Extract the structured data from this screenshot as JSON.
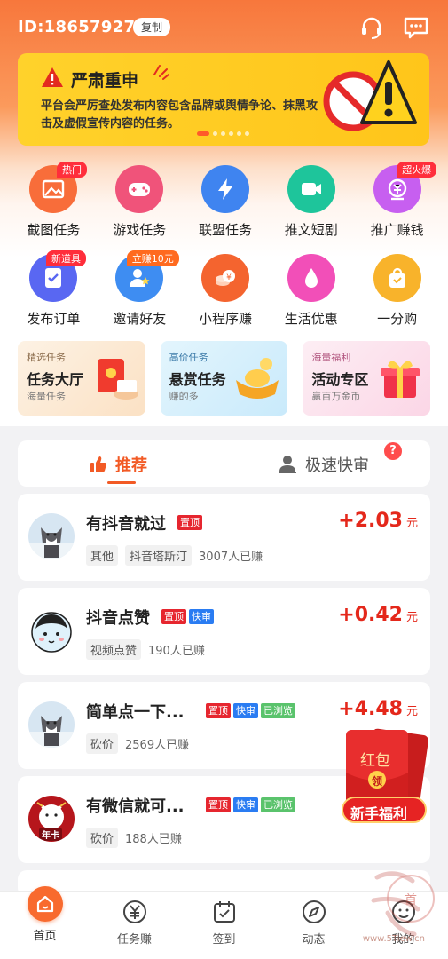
{
  "header": {
    "user_id": "ID:18657927",
    "copy_label": "复制",
    "icons": [
      "headset-icon",
      "message-icon"
    ]
  },
  "banner": {
    "title": "严肃重申",
    "text": "平台会严厉查处发布内容包含品牌或舆情争论、抹黑攻击及虚假宣传内容的任务。",
    "slide_count": 6,
    "active_slide": 1
  },
  "grid": {
    "rows": [
      [
        {
          "label": "截图任务",
          "badge": "热门",
          "icon": "image-icon",
          "color": "#f86d3a"
        },
        {
          "label": "游戏任务",
          "badge": "",
          "icon": "gamepad-icon",
          "color": "#f0537a"
        },
        {
          "label": "联盟任务",
          "badge": "",
          "icon": "lightning-icon",
          "color": "#3f84f0"
        },
        {
          "label": "推文短剧",
          "badge": "",
          "icon": "video-icon",
          "color": "#1ec59b"
        },
        {
          "label": "推广赚钱",
          "badge": "超火爆",
          "icon": "coin-icon",
          "color": "#c75ff0"
        }
      ],
      [
        {
          "label": "发布订单",
          "badge": "新道具",
          "icon": "order-icon",
          "color": "#5967f2"
        },
        {
          "label": "邀请好友",
          "badge": "立赚10元",
          "icon": "friend-icon",
          "color": "#3e8df2"
        },
        {
          "label": "小程序赚",
          "badge": "",
          "icon": "coins-icon",
          "color": "#f4642f"
        },
        {
          "label": "生活优惠",
          "badge": "",
          "icon": "drop-icon",
          "color": "#f24fb8"
        },
        {
          "label": "一分购",
          "badge": "",
          "icon": "bag-icon",
          "color": "#f8b32b"
        }
      ]
    ]
  },
  "promos": [
    {
      "tag": "精选任务",
      "title": "任务大厅",
      "sub": "海量任务",
      "bg": "#fdeedd"
    },
    {
      "tag": "高价任务",
      "title": "悬赏任务",
      "sub": "赚的多",
      "bg": "#dbf1fb"
    },
    {
      "tag": "海量福利",
      "title": "活动专区",
      "sub": "赢百万金币",
      "bg": "#fde6f0"
    }
  ],
  "tabs": [
    {
      "label": "推荐",
      "active": true
    },
    {
      "label": "极速快审",
      "active": false
    }
  ],
  "help_mark": "?",
  "tasks": [
    {
      "title": "有抖音就过",
      "tags": [
        {
          "text": "置顶",
          "color": "red"
        }
      ],
      "chips": [
        "其他",
        "抖音塔斯汀"
      ],
      "count": "3007人已赚",
      "reward": "+2.03",
      "unit": "元",
      "avatar": "husky"
    },
    {
      "title": "抖音点赞",
      "tags": [
        {
          "text": "置顶",
          "color": "red"
        },
        {
          "text": "快审",
          "color": "blue"
        }
      ],
      "chips": [
        "视频点赞"
      ],
      "count": "190人已赚",
      "reward": "+0.42",
      "unit": "元",
      "avatar": "cartoon"
    },
    {
      "title": "简单点一下...",
      "tags": [
        {
          "text": "置顶",
          "color": "red"
        },
        {
          "text": "快审",
          "color": "blue"
        },
        {
          "text": "已浏览",
          "color": "green"
        }
      ],
      "chips": [
        "砍价"
      ],
      "count": "2569人已赚",
      "reward": "+4.48",
      "unit": "元",
      "avatar": "husky"
    },
    {
      "title": "有微信就可...",
      "tags": [
        {
          "text": "置顶",
          "color": "red"
        },
        {
          "text": "快审",
          "color": "blue"
        },
        {
          "text": "已浏览",
          "color": "green"
        }
      ],
      "chips": [
        "砍价"
      ],
      "count": "188人已赚",
      "reward": "",
      "unit": "",
      "avatar": "card",
      "avatar_text": "年卡"
    }
  ],
  "float_pack": {
    "line1": "红包",
    "seal": "领",
    "line2": "新手福利"
  },
  "nav": [
    {
      "label": "首页",
      "icon": "home-icon",
      "active": true
    },
    {
      "label": "任务赚",
      "icon": "yen-icon",
      "active": false
    },
    {
      "label": "签到",
      "icon": "calendar-icon",
      "active": false
    },
    {
      "label": "动态",
      "icon": "compass-icon",
      "active": false
    },
    {
      "label": "我的",
      "icon": "profile-icon",
      "active": false
    }
  ],
  "watermark": {
    "seal": "首",
    "site": "www.5Tiew.cn"
  }
}
